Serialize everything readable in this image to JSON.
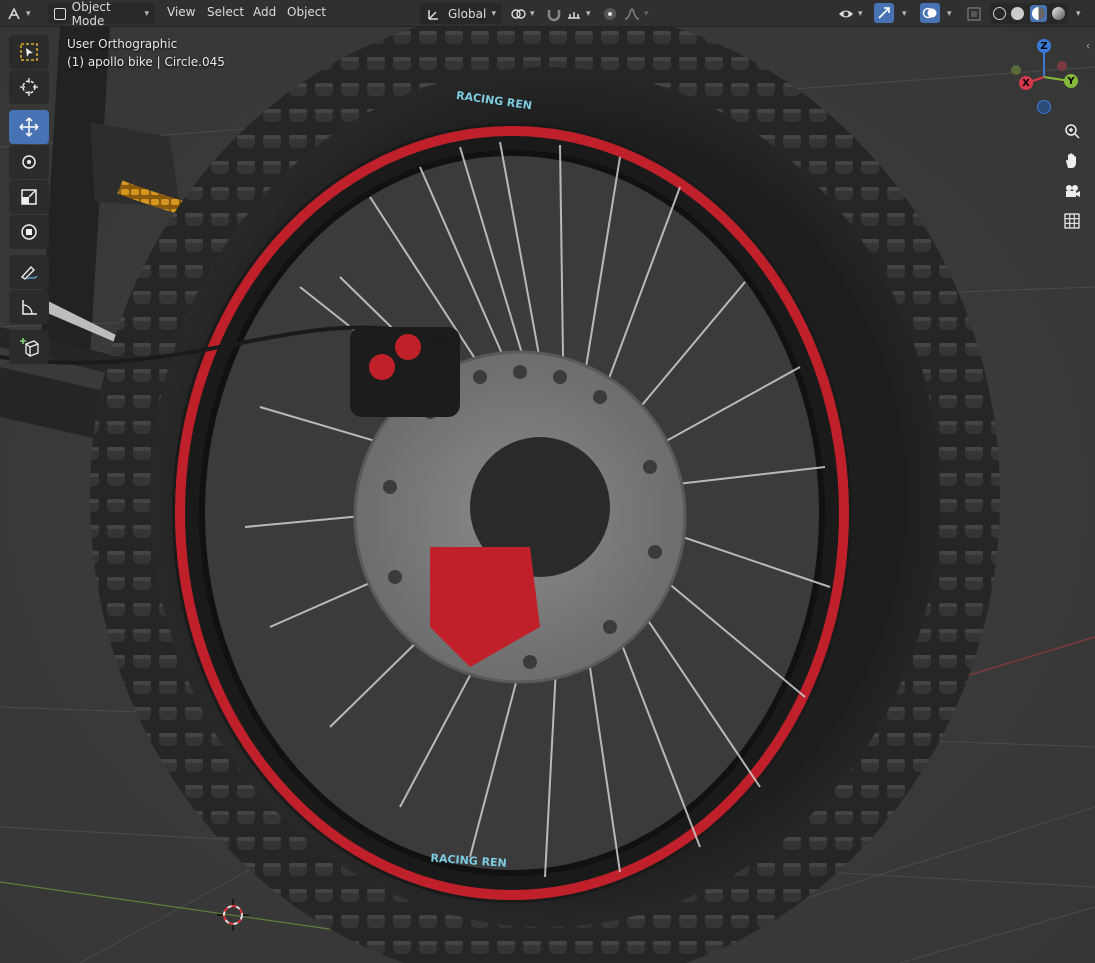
{
  "header": {
    "mode_label": "Object Mode",
    "menus": [
      "View",
      "Select",
      "Add",
      "Object"
    ],
    "transform_orientation": "Global"
  },
  "viewport": {
    "view_name": "User Orthographic",
    "object_info": "(1) apollo bike | Circle.045"
  },
  "gizmo": {
    "z_label": "Z",
    "y_label": "Y",
    "x_label": "X"
  },
  "tools": [
    "select-box",
    "cursor",
    "move",
    "rotate",
    "scale",
    "transform",
    "annotate",
    "measure",
    "add-cube"
  ],
  "rim_decal": "RACING REN",
  "colors": {
    "accent": "#4772b3",
    "rim_red": "#c0202a",
    "tire": "#2a2a2a",
    "chain": "#c98a1c"
  }
}
